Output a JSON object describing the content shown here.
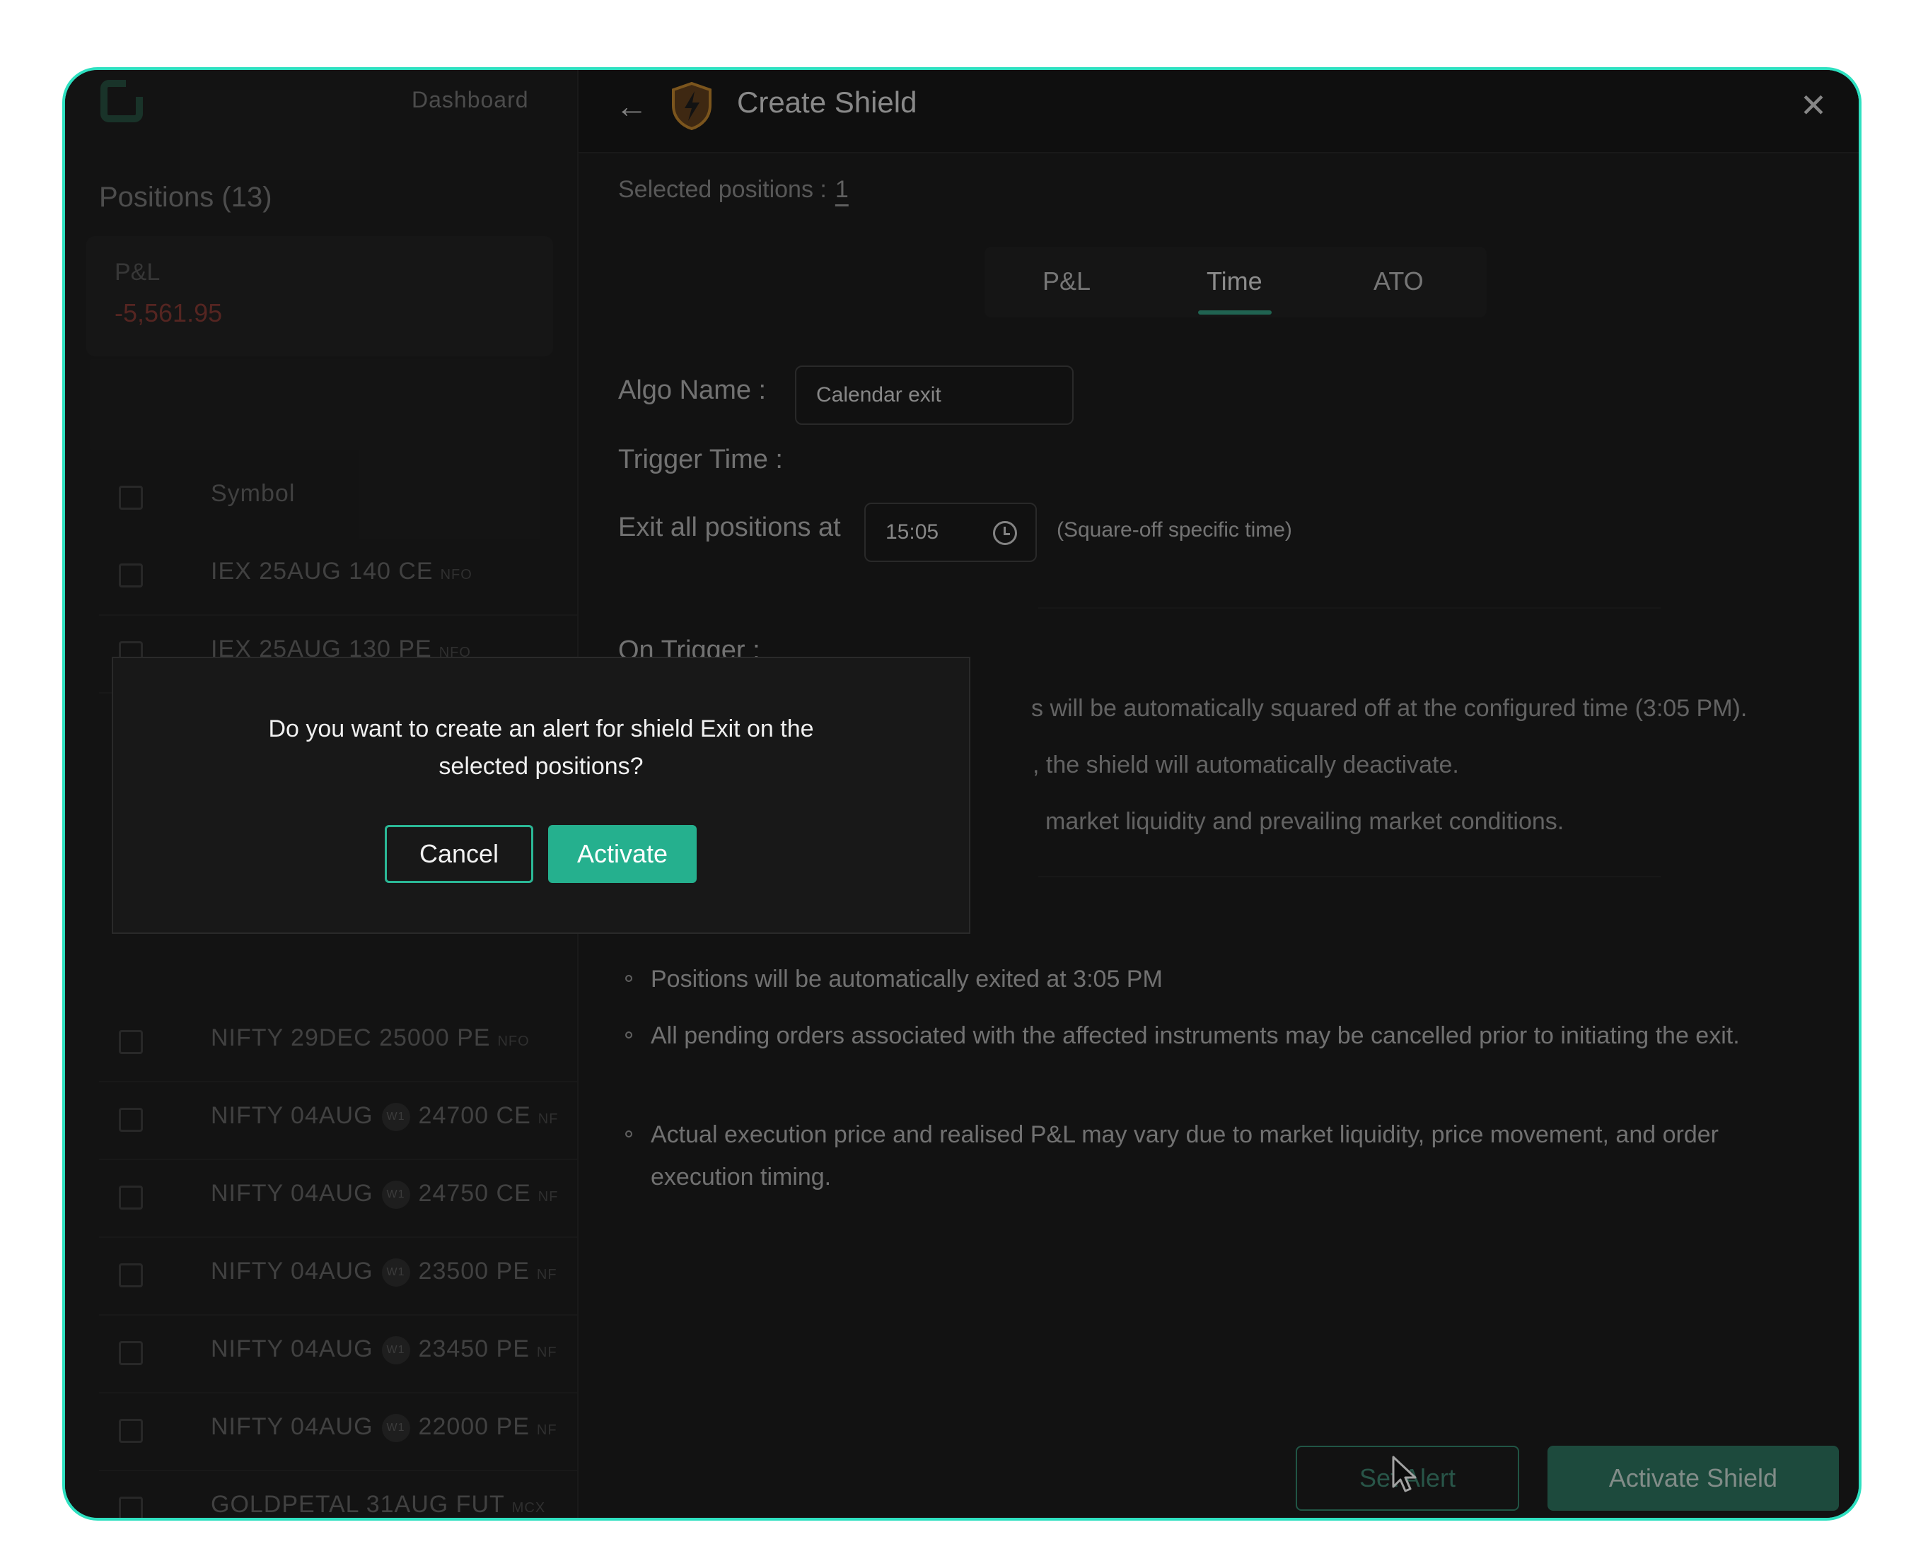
{
  "sidebar": {
    "dashboard_label": "Dashboard",
    "positions_title": "Positions (13)",
    "pnl_label": "P&L",
    "pnl_value": "-5,561.95",
    "symbol_header": "Symbol",
    "rows": [
      {
        "symbol": "IEX 25AUG 140 CE",
        "weekly": "",
        "strike": "",
        "exchange": "NFO"
      },
      {
        "symbol": "IEX 25AUG 130 PE",
        "weekly": "",
        "strike": "",
        "exchange": "NFO"
      },
      {
        "symbol": "NIFTY 29DEC 25000 PE",
        "weekly": "",
        "strike": "",
        "exchange": "NFO"
      },
      {
        "symbol": "NIFTY 04AUG",
        "weekly": "W1",
        "strike": "24700 CE",
        "exchange": "NF"
      },
      {
        "symbol": "NIFTY 04AUG",
        "weekly": "W1",
        "strike": "24750 CE",
        "exchange": "NF"
      },
      {
        "symbol": "NIFTY 04AUG",
        "weekly": "W1",
        "strike": "23500 PE",
        "exchange": "NF"
      },
      {
        "symbol": "NIFTY 04AUG",
        "weekly": "W1",
        "strike": "23450 PE",
        "exchange": "NF"
      },
      {
        "symbol": "NIFTY 04AUG",
        "weekly": "W1",
        "strike": "22000 PE",
        "exchange": "NF"
      },
      {
        "symbol": "GOLDPETAL 31AUG FUT",
        "weekly": "",
        "strike": "",
        "exchange": "MCX"
      }
    ]
  },
  "panel": {
    "title": "Create Shield",
    "selected_label": "Selected positions :",
    "selected_count": "1",
    "tabs": [
      "P&L",
      "Time",
      "ATO"
    ],
    "active_tab": "Time",
    "algo_label": "Algo Name :",
    "algo_value": "Calendar exit",
    "trigger_label": "Trigger Time :",
    "exit_label": "Exit all positions at",
    "exit_time": "15:05",
    "exit_hint": "(Square-off specific time)",
    "on_trigger_label": "On Trigger :",
    "trigger_lines": [
      "s will be automatically squared off at the configured time (3:05 PM).",
      ", the shield will automatically deactivate.",
      "market liquidity and prevailing market conditions."
    ],
    "notes": [
      "Positions will be automatically exited at 3:05 PM",
      "All pending orders associated with the affected instruments may be cancelled prior to initiating the exit.",
      "Actual execution price and realised P&L may vary due to market liquidity, price movement, and order execution timing."
    ],
    "set_alert_label": "Set Alert",
    "activate_shield_label": "Activate Shield"
  },
  "modal": {
    "question": "Do you want to create an alert for shield Exit on the selected positions?",
    "cancel_label": "Cancel",
    "activate_label": "Activate"
  },
  "colors": {
    "accent": "#25b08e",
    "frame_border": "#2ee0c0",
    "negative": "#7a3530"
  }
}
